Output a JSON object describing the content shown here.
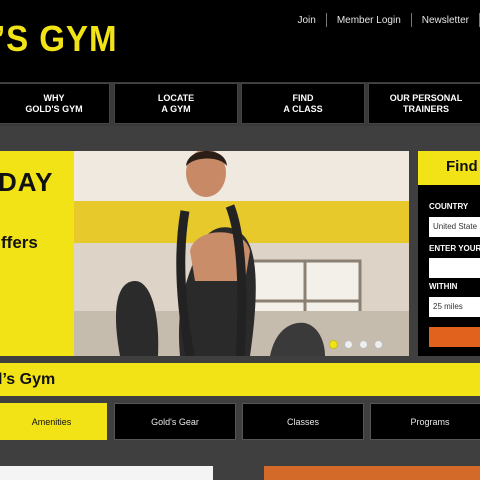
{
  "header": {
    "logo_text": "’S GYM",
    "links": [
      "Join",
      "Member Login",
      "Newsletter"
    ]
  },
  "nav": {
    "items": [
      {
        "line1": "WHY",
        "line2": "GOLD'S GYM"
      },
      {
        "line1": "LOCATE",
        "line2": "A GYM"
      },
      {
        "line1": "FIND",
        "line2": "A CLASS"
      },
      {
        "line1": "OUR PERSONAL",
        "line2": "TRAINERS"
      }
    ]
  },
  "hero": {
    "headline": "DAY",
    "subline": "ffers",
    "dots": 4,
    "active_dot": 0
  },
  "finder": {
    "title": "Find Y",
    "country_label": "COUNTRY",
    "country_value": "United State",
    "zip_label": "ENTER YOUR",
    "zip_value": "",
    "within_label": "WITHIN",
    "within_value": "25 miles"
  },
  "section": {
    "title": "l’s Gym"
  },
  "tabs": [
    "Amenities",
    "Gold's Gear",
    "Classes",
    "Programs"
  ],
  "colors": {
    "accent": "#f2e317",
    "button_orange": "#e0621d",
    "background": "#000000",
    "band": "#3f3f3f"
  }
}
